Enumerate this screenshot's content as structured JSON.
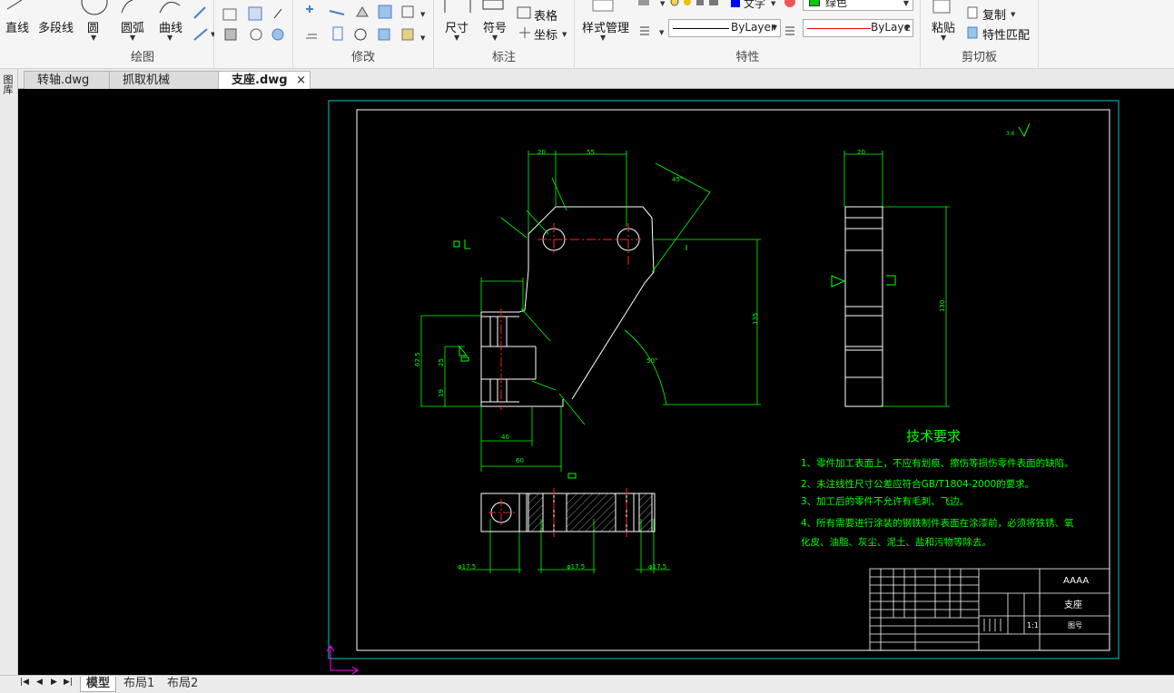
{
  "ribbon": {
    "draw": {
      "label": "绘图",
      "line": "直线",
      "polyline": "多段线",
      "circle": "圆",
      "arc": "圆弧",
      "curve": "曲线"
    },
    "modify": {
      "label": "修改"
    },
    "annotate": {
      "label": "标注",
      "dimension": "尺寸",
      "symbol": "符号",
      "table": "表格",
      "coordinate": "坐标"
    },
    "properties": {
      "label": "特性",
      "style_manager": "样式管理",
      "text_style": "文字",
      "color": "绿色",
      "linetype": "ByLayer",
      "lineweight": "ByLaye",
      "color_hex": "#00cc00"
    },
    "clipboard": {
      "label": "剪切板",
      "paste": "粘贴",
      "copy": "复制",
      "match_properties": "特性匹配"
    }
  },
  "tabs": [
    {
      "label": "转轴.dwg"
    },
    {
      "label": "抓取机械手.dwg"
    },
    {
      "label": "支座.dwg",
      "close": "×"
    }
  ],
  "sidebar": {
    "label": "图库"
  },
  "layouts": {
    "model": "模型",
    "layout1": "布局1",
    "layout2": "布局2"
  },
  "drawing": {
    "tech_title": "技术要求",
    "tech_lines": [
      "1、零件加工表面上，不应有划痕、擦伤等损伤零件表面的缺陷。",
      "2、未注线性尺寸公差应符合GB/T1804-2000的要求。",
      "3、加工后的零件不允许有毛刺、飞边。",
      "4、所有需要进行涂装的钢铁制件表面在涂漆前，必须将铁锈、氧",
      "化皮、油脂、灰尘、泥土、盐和污物等除去。"
    ],
    "title_block": {
      "part_name": "支座",
      "code": "AAAA",
      "drawing_no": "图号",
      "scale": "1:1"
    },
    "dims": {
      "d20": "20",
      "d55": "55",
      "d40": "40",
      "d60": "60",
      "d45": "45°",
      "d50": "50°",
      "d135": "135",
      "d130": "130",
      "d625": "62.5",
      "d25": "25",
      "d19": "19",
      "d20b": "20",
      "phi175a": "φ17.5",
      "phi175b": "φ17.5",
      "phi175c": "φ17.5"
    },
    "colors": {
      "border": "#ffffff",
      "sheet": "#00c8c8",
      "dim": "#00ff00",
      "center": "#ff0000",
      "ucs": "#ff00ff"
    }
  }
}
